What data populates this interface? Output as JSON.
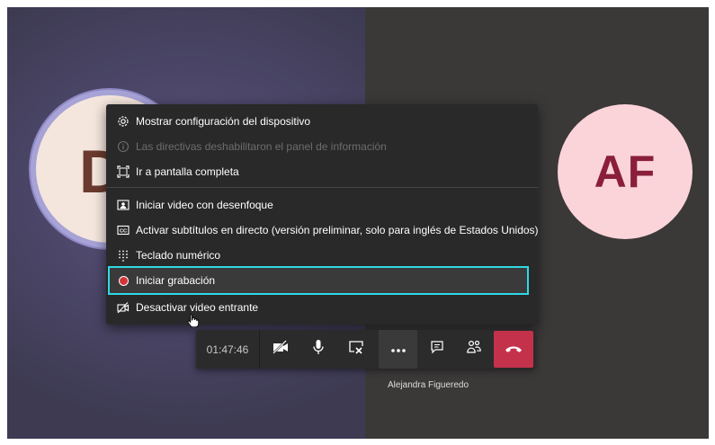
{
  "participants": {
    "left_initial": "D",
    "right_initials": "AF",
    "right_name": "Alejandra Figueredo"
  },
  "menu": {
    "items": [
      {
        "label": "Mostrar configuración del dispositivo",
        "icon": "gear-icon",
        "disabled": false
      },
      {
        "label": "Las directivas deshabilitaron el panel de información",
        "icon": "info-icon",
        "disabled": true
      },
      {
        "label": "Ir a pantalla completa",
        "icon": "fullscreen-icon",
        "disabled": false
      },
      {
        "label": "Iniciar video con desenfoque",
        "icon": "blur-background-icon",
        "disabled": false
      },
      {
        "label": "Activar subtítulos en directo (versión preliminar, solo para inglés de Estados Unidos)",
        "icon": "closed-captions-icon",
        "disabled": false
      },
      {
        "label": "Teclado numérico",
        "icon": "dialpad-icon",
        "disabled": false
      },
      {
        "label": "Iniciar grabación",
        "icon": "record-icon",
        "disabled": false,
        "highlighted": true
      },
      {
        "label": "Desactivar video entrante",
        "icon": "video-off-icon",
        "disabled": false
      }
    ]
  },
  "callbar": {
    "timer": "01:47:46",
    "buttons": [
      "camera-off-icon",
      "microphone-icon",
      "stop-share-icon",
      "more-options-icon",
      "chat-icon",
      "participants-icon",
      "hang-up-icon"
    ]
  },
  "colors": {
    "highlight": "#2fd9e6",
    "hangup": "#c4314b",
    "record": "#d13438",
    "avatar_right_bg": "#fbd4da",
    "avatar_right_text": "#8a1f3a"
  }
}
